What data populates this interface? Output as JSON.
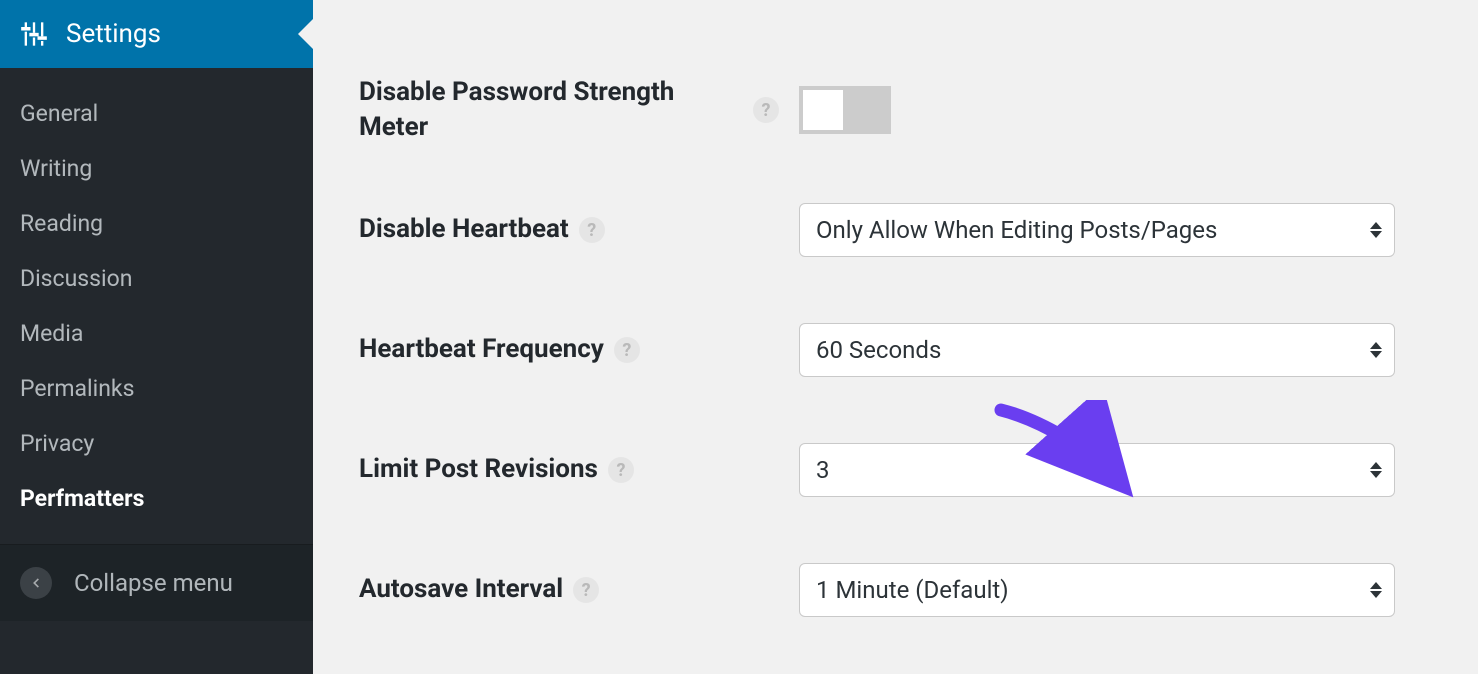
{
  "sidebar": {
    "current": {
      "label": "Settings",
      "icon": "sliders-icon"
    },
    "items": [
      {
        "label": "General",
        "active": false
      },
      {
        "label": "Writing",
        "active": false
      },
      {
        "label": "Reading",
        "active": false
      },
      {
        "label": "Discussion",
        "active": false
      },
      {
        "label": "Media",
        "active": false
      },
      {
        "label": "Permalinks",
        "active": false
      },
      {
        "label": "Privacy",
        "active": false
      },
      {
        "label": "Perfmatters",
        "active": true
      }
    ],
    "collapse_label": "Collapse menu"
  },
  "settings": {
    "password_meter": {
      "label": "Disable Password Strength Meter",
      "value": false
    },
    "disable_heartbeat": {
      "label": "Disable Heartbeat",
      "value": "Only Allow When Editing Posts/Pages"
    },
    "heartbeat_frequency": {
      "label": "Heartbeat Frequency",
      "value": "60 Seconds"
    },
    "limit_revisions": {
      "label": "Limit Post Revisions",
      "value": "3"
    },
    "autosave_interval": {
      "label": "Autosave Interval",
      "value": "1 Minute (Default)"
    }
  },
  "help_glyph": "?",
  "annotation": {
    "type": "arrow",
    "points_to": "limit-post-revisions-select",
    "color": "#6a3ef0"
  }
}
